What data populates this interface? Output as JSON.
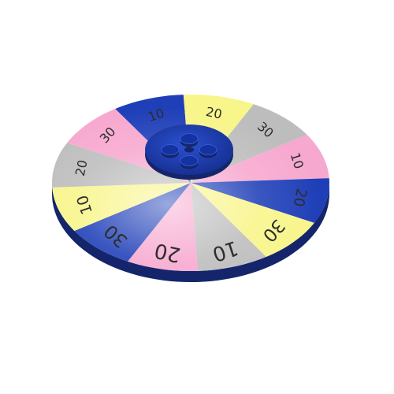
{
  "colors": {
    "background": "#ffffff",
    "blue": "#1f3fb8",
    "pink": "#f7a8cf",
    "gray": "#bdbdbd",
    "yellow": "#f8f58a",
    "rim": "#14256b",
    "hub": "#1b3aa8",
    "stud": "#1533a0",
    "label": "#2d2d2d"
  },
  "wheel": {
    "segments": [
      {
        "color": "blue",
        "label": "10"
      },
      {
        "color": "yellow",
        "label": "20"
      },
      {
        "color": "gray",
        "label": "30"
      },
      {
        "color": "pink",
        "label": "10"
      },
      {
        "color": "blue",
        "label": "20"
      },
      {
        "color": "yellow",
        "label": "30"
      },
      {
        "color": "gray",
        "label": "10"
      },
      {
        "color": "pink",
        "label": "20"
      },
      {
        "color": "blue",
        "label": "30"
      },
      {
        "color": "yellow",
        "label": "10"
      },
      {
        "color": "gray",
        "label": "20"
      },
      {
        "color": "pink",
        "label": "30"
      }
    ],
    "hub_studs": 4
  }
}
